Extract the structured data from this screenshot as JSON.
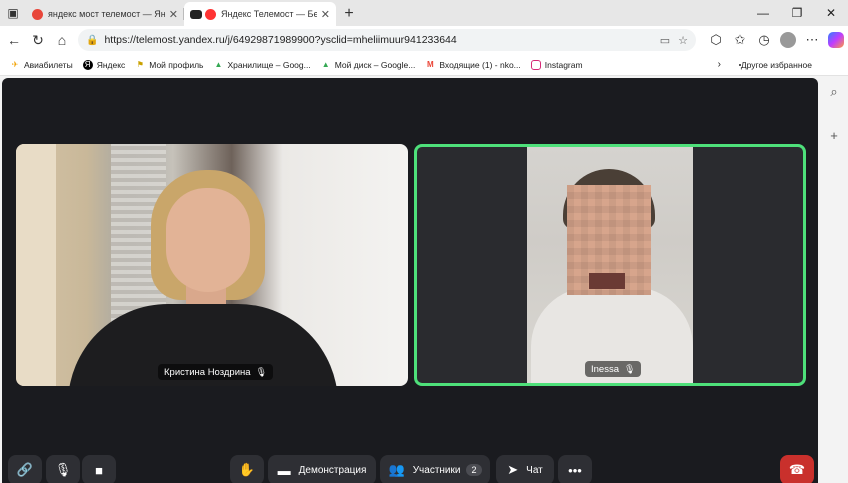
{
  "browser": {
    "tabs": [
      {
        "title": "яндекс мост телемост — Яндекс",
        "favicon_color": "#e8463a",
        "active": false
      },
      {
        "title": "Яндекс Телемост — Бесплат",
        "favicon_color": "#ff3333",
        "active": true
      }
    ],
    "new_tab_glyph": "+",
    "url": "https://telemost.yandex.ru/j/64929871989900?ysclid=mheliimuur941233644",
    "bookmarks": [
      {
        "label": "Авиабилеты",
        "icon": "plane-icon",
        "color": "#f2a100"
      },
      {
        "label": "Яндекс",
        "icon": "yandex-icon",
        "color": "#000000"
      },
      {
        "label": "Мой профиль",
        "icon": "profile-icon",
        "color": "#c9a100"
      },
      {
        "label": "Хранилище – Goog...",
        "icon": "drive-icon",
        "color": "#34a853"
      },
      {
        "label": "Мой диск – Google...",
        "icon": "drive-icon",
        "color": "#34a853"
      },
      {
        "label": "Входящие (1) - nko...",
        "icon": "gmail-icon",
        "color": "#ea4335"
      },
      {
        "label": "Instagram",
        "icon": "instagram-icon",
        "color": "#d62976"
      }
    ],
    "other_bookmarks": "Другое избранное"
  },
  "meeting": {
    "participants": [
      {
        "name": "Кристина Ноздрина",
        "speaking": false
      },
      {
        "name": "Inessa",
        "speaking": true
      }
    ],
    "controls": {
      "demonstration_label": "Демонстрация",
      "participants_label": "Участники",
      "participants_count": "2",
      "chat_label": "Чат"
    },
    "accent_color": "#4ee07a"
  }
}
